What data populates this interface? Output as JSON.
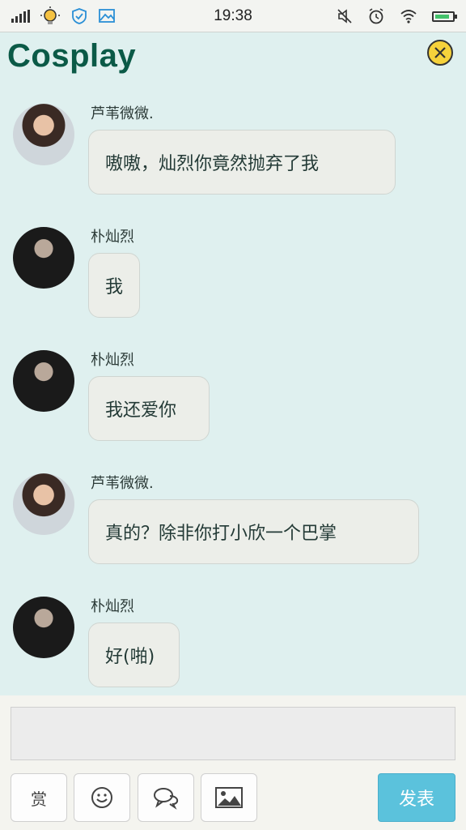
{
  "status_bar": {
    "time": "19:38",
    "icons": [
      "signal-icon",
      "bulb-icon",
      "shield-check-icon",
      "image-icon",
      "mute-icon",
      "alarm-icon",
      "wifi-icon",
      "battery-icon"
    ]
  },
  "header": {
    "title": "Cosplay",
    "close_icon": "close-icon"
  },
  "messages": [
    {
      "sender": "芦苇微微.",
      "text": "嗷嗷，灿烈你竟然抛弃了我",
      "avatar": "female-avatar"
    },
    {
      "sender": "朴灿烈",
      "text": "我",
      "avatar": "male-avatar"
    },
    {
      "sender": "朴灿烈",
      "text": "我还爱你",
      "avatar": "male-avatar"
    },
    {
      "sender": "芦苇微微.",
      "text": "真的？除非你打小欣一个巴掌",
      "avatar": "female-avatar"
    },
    {
      "sender": "朴灿烈",
      "text": "好(啪)",
      "avatar": "male-avatar"
    }
  ],
  "composer": {
    "reward_label": "赏",
    "send_label": "发表",
    "tools": [
      "reward-button",
      "emoji-icon",
      "chat-icon",
      "picture-icon"
    ]
  },
  "colors": {
    "title": "#0b5a47",
    "background": "#dff0ef",
    "send_button": "#5bc2dc",
    "close_button": "#f6d23b"
  }
}
